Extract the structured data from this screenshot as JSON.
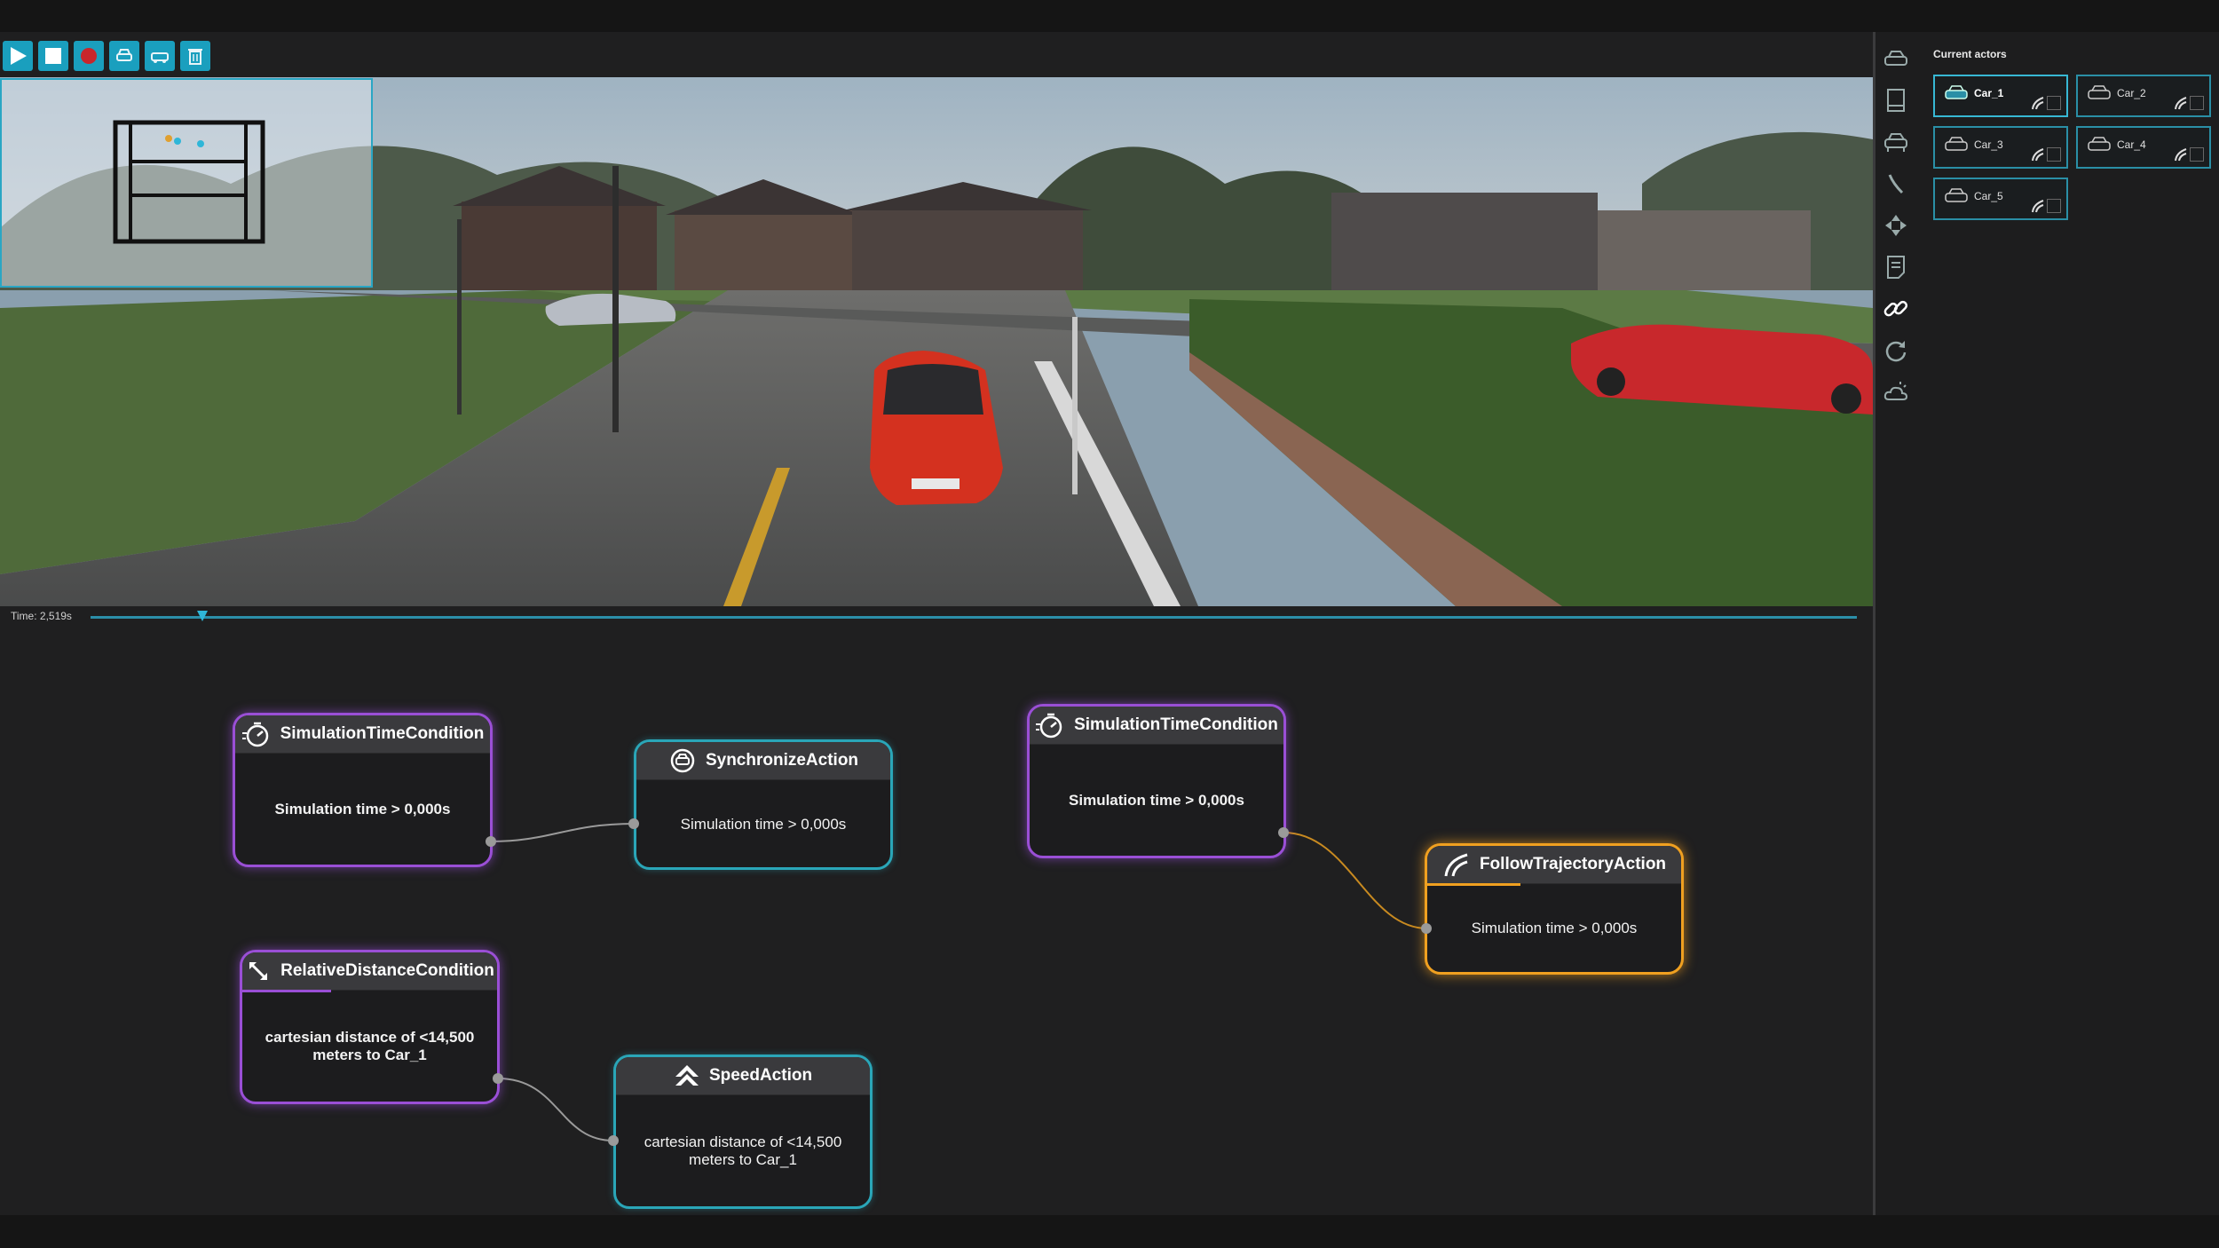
{
  "toolbar": {
    "buttons": [
      "play-icon",
      "stop-icon",
      "record-icon",
      "car-swap-icon",
      "car-add-icon",
      "delete-icon"
    ],
    "accent": "#1a9fbe"
  },
  "timeline": {
    "label": "Time: 2,519s",
    "progress": 0.06
  },
  "graph": {
    "nodes": [
      {
        "id": "n1",
        "title": "SimulationTimeCondition",
        "body": "Simulation time > 0,000s",
        "style": "condition",
        "icon": "stopwatch-icon"
      },
      {
        "id": "n2",
        "title": "SynchronizeAction",
        "body": "Simulation time > 0,000s",
        "style": "action",
        "icon": "sync-car-icon"
      },
      {
        "id": "n3",
        "title": "SimulationTimeCondition",
        "body": "Simulation time > 0,000s",
        "style": "condition",
        "icon": "stopwatch-icon"
      },
      {
        "id": "n4",
        "title": "FollowTrajectoryAction",
        "body": "Simulation time > 0,000s",
        "style": "active-action",
        "icon": "trajectory-icon"
      },
      {
        "id": "n5",
        "title": "RelativeDistanceCondition",
        "body": "cartesian distance of <14,500 meters to Car_1",
        "style": "condition",
        "icon": "distance-icon"
      },
      {
        "id": "n6",
        "title": "SpeedAction",
        "body": "cartesian distance of <14,500 meters to Car_1",
        "style": "action",
        "icon": "speed-icon"
      }
    ],
    "colors": {
      "condition": "#9a4fd6",
      "action": "#2aa6b8",
      "active": "#f0a020"
    }
  },
  "side_icons": [
    "vehicle-icon",
    "book-icon",
    "car-icon",
    "route-icon",
    "move-icon",
    "notes-icon",
    "link-icon",
    "refresh-icon",
    "weather-icon"
  ],
  "actors": {
    "title": "Current actors",
    "items": [
      {
        "name": "Car_1",
        "selected": true
      },
      {
        "name": "Car_2",
        "selected": false
      },
      {
        "name": "Car_3",
        "selected": false
      },
      {
        "name": "Car_4",
        "selected": false
      },
      {
        "name": "Car_5",
        "selected": false
      }
    ]
  }
}
